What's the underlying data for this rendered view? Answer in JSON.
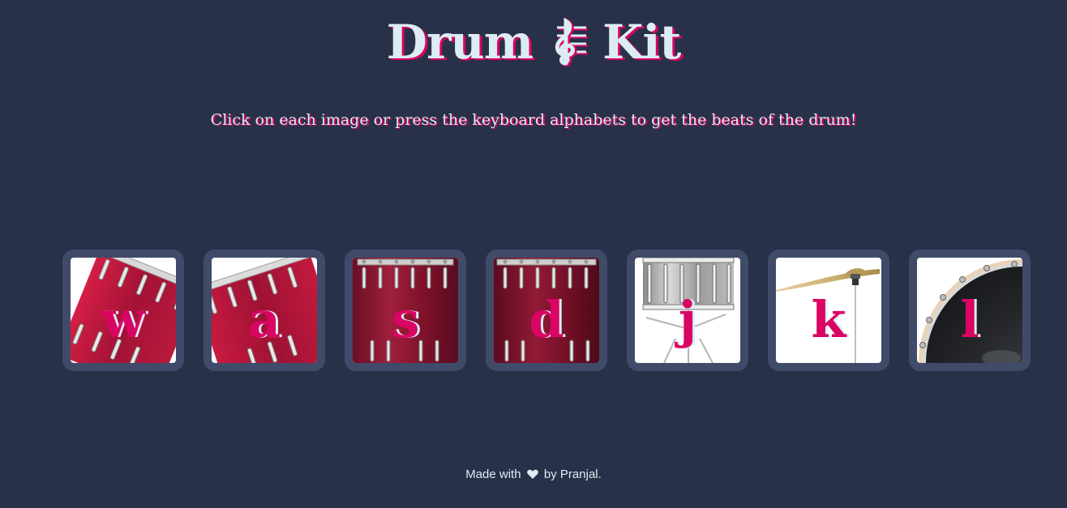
{
  "header": {
    "title_left": "Drum",
    "title_icon": "treble-clef-icon",
    "title_right": "Kit",
    "instructions": "Click on each image or press the keyboard alphabets to get the beats of the drum!"
  },
  "drums": [
    {
      "key": "w",
      "icon": "tom-drum-icon"
    },
    {
      "key": "a",
      "icon": "tom-drum-icon"
    },
    {
      "key": "s",
      "icon": "floor-tom-icon"
    },
    {
      "key": "d",
      "icon": "floor-tom-icon"
    },
    {
      "key": "j",
      "icon": "snare-drum-icon"
    },
    {
      "key": "k",
      "icon": "cymbal-icon"
    },
    {
      "key": "l",
      "icon": "bass-drum-icon"
    }
  ],
  "footer": {
    "made_with": "Made with",
    "heart_icon": "heart-icon",
    "by": "by Pranjal."
  },
  "colors": {
    "background": "#283149",
    "tile": "#404b69",
    "accent": "#da0463",
    "text": "#dbedf3"
  }
}
